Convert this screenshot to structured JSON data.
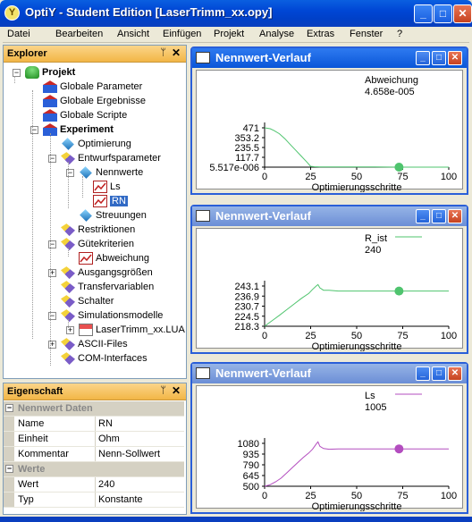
{
  "window": {
    "title": "OptiY - Student Edition [LaserTrimm_xx.opy]",
    "app_icon": "Y"
  },
  "menu": [
    "Datei",
    "Bearbeiten",
    "Ansicht",
    "Einfügen",
    "Projekt",
    "Analyse",
    "Extras",
    "Fenster",
    "?"
  ],
  "explorer": {
    "title": "Explorer",
    "items": [
      {
        "label": "Projekt",
        "icon": "database-icon"
      },
      {
        "label": "Globale Parameter",
        "icon": "building-icon"
      },
      {
        "label": "Globale Ergebnisse",
        "icon": "building-icon"
      },
      {
        "label": "Globale Scripte",
        "icon": "building-icon"
      },
      {
        "label": "Experiment",
        "icon": "building-icon"
      },
      {
        "label": "Optimierung",
        "icon": "diamond-icon"
      },
      {
        "label": "Entwurfsparameter",
        "icon": "parameter-icon"
      },
      {
        "label": "Nennwerte",
        "icon": "diamond-icon"
      },
      {
        "label": "Ls",
        "icon": "chart-icon"
      },
      {
        "label": "RN",
        "icon": "chart-icon"
      },
      {
        "label": "Streuungen",
        "icon": "diamond-icon"
      },
      {
        "label": "Restriktionen",
        "icon": "parameter-icon"
      },
      {
        "label": "Gütekriterien",
        "icon": "parameter-icon"
      },
      {
        "label": "Abweichung",
        "icon": "function-icon"
      },
      {
        "label": "Ausgangsgrößen",
        "icon": "parameter-icon"
      },
      {
        "label": "Transfervariablen",
        "icon": "parameter-icon"
      },
      {
        "label": "Schalter",
        "icon": "parameter-icon"
      },
      {
        "label": "Simulationsmodelle",
        "icon": "parameter-icon"
      },
      {
        "label": "LaserTrimm_xx.LUA",
        "icon": "file-icon"
      },
      {
        "label": "ASCII-Files",
        "icon": "parameter-icon"
      },
      {
        "label": "COM-Interfaces",
        "icon": "parameter-icon"
      }
    ]
  },
  "properties": {
    "title": "Eigenschaft",
    "categories": [
      {
        "name": "Nennwert Daten",
        "rows": [
          {
            "name": "Name",
            "value": "RN"
          },
          {
            "name": "Einheit",
            "value": "Ohm"
          },
          {
            "name": "Kommentar",
            "value": "Nenn-Sollwert"
          }
        ]
      },
      {
        "name": "Werte",
        "rows": [
          {
            "name": "Wert",
            "value": "240"
          },
          {
            "name": "Typ",
            "value": "Konstante"
          }
        ]
      }
    ]
  },
  "chart_data": [
    {
      "type": "line",
      "title": "Nennwert-Verlauf",
      "xlabel": "Optimierungsschritte",
      "legend": "Abweichung",
      "legend_value": "4.658e-005",
      "yticks": [
        "471",
        "353.2",
        "235.5",
        "117.7",
        "5.517e-006"
      ],
      "ytick_values": [
        471,
        353.2,
        235.5,
        117.7,
        0
      ],
      "xticks": [
        "0",
        "25",
        "50",
        "75",
        "100"
      ],
      "ylim": [
        0,
        471
      ],
      "xlim": [
        0,
        100
      ],
      "color": "#4fc46e",
      "series": [
        {
          "name": "Abweichung",
          "x": [
            0,
            3,
            5,
            8,
            11,
            14,
            17,
            20,
            23,
            25,
            27,
            30,
            40,
            50,
            60,
            73,
            100
          ],
          "y": [
            471,
            460,
            440,
            400,
            340,
            270,
            200,
            130,
            60,
            10,
            5,
            3,
            2,
            2,
            2,
            0,
            0
          ]
        }
      ],
      "marker": {
        "x": 73,
        "y": 0
      }
    },
    {
      "type": "line",
      "title": "Nennwert-Verlauf",
      "xlabel": "Optimierungsschritte",
      "legend": "R_ist",
      "legend_value": "240",
      "yticks": [
        "243.1",
        "236.9",
        "230.7",
        "224.5",
        "218.3"
      ],
      "ytick_values": [
        243.1,
        236.9,
        230.7,
        224.5,
        218.3
      ],
      "xticks": [
        "0",
        "25",
        "50",
        "75",
        "100"
      ],
      "ylim": [
        218.3,
        243.1
      ],
      "xlim": [
        0,
        100
      ],
      "color": "#4fc46e",
      "series": [
        {
          "name": "R_ist",
          "x": [
            0,
            2,
            5,
            8,
            12,
            16,
            20,
            24,
            26,
            28,
            29,
            30,
            32,
            35,
            40,
            50,
            60,
            73,
            100
          ],
          "y": [
            218.3,
            220,
            222.5,
            225,
            228.5,
            232,
            235.5,
            238.5,
            241,
            243.1,
            244,
            242,
            240.5,
            240.5,
            240,
            240,
            240,
            240,
            240
          ]
        }
      ],
      "marker": {
        "x": 73,
        "y": 240
      }
    },
    {
      "type": "line",
      "title": "Nennwert-Verlauf",
      "xlabel": "Optimierungsschritte",
      "legend": "Ls",
      "legend_value": "1005",
      "yticks": [
        "1080",
        "935",
        "790",
        "645",
        "500"
      ],
      "ytick_values": [
        1080,
        935,
        790,
        645,
        500
      ],
      "xticks": [
        "0",
        "25",
        "50",
        "75",
        "100"
      ],
      "ylim": [
        500,
        1080
      ],
      "xlim": [
        0,
        100
      ],
      "color": "#b34dbf",
      "series": [
        {
          "name": "Ls",
          "x": [
            0,
            3,
            6,
            9,
            12,
            15,
            18,
            21,
            24,
            26,
            28,
            29,
            30,
            32,
            35,
            40,
            50,
            60,
            73,
            100
          ],
          "y": [
            500,
            520,
            560,
            610,
            680,
            750,
            820,
            890,
            950,
            1000,
            1070,
            1100,
            1040,
            1010,
            1000,
            1005,
            1005,
            1005,
            1005,
            1005
          ]
        }
      ],
      "marker": {
        "x": 73,
        "y": 1005
      }
    }
  ]
}
